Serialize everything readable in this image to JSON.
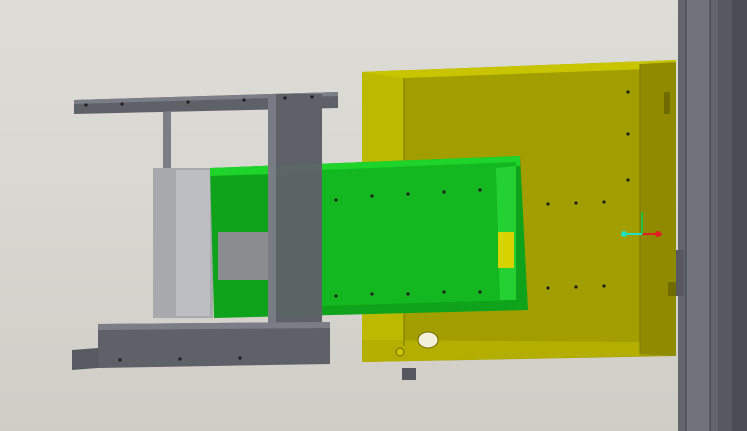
{
  "viewport": {
    "kind": "3d-cad-model-view",
    "labels": []
  },
  "parts": [
    {
      "id": "yellow-tray",
      "color": "#a39e00",
      "highlight": "#c9c400"
    },
    {
      "id": "green-drawer",
      "color": "#0ea31a",
      "highlight": "#1ed42a"
    },
    {
      "id": "gray-frame",
      "color": "#5e6168",
      "highlight": "#7b7e86"
    },
    {
      "id": "right-column",
      "color": "#6c6f76"
    }
  ],
  "triad": {
    "x_color": "#e02020",
    "y_color": "#20c040",
    "z_color": "#20e0c0"
  }
}
